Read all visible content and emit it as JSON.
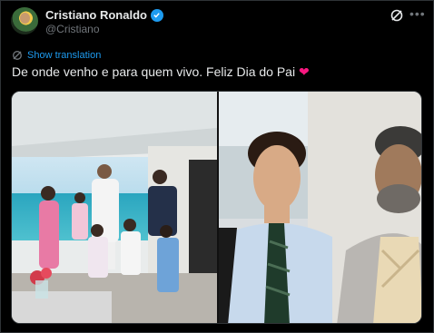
{
  "tweet": {
    "author_name": "Cristiano Ronaldo",
    "handle": "@Cristiano",
    "show_translation": "Show translation",
    "text": "De onde venho e para quem vivo. Feliz Dia do Pai",
    "emoji": "❤"
  },
  "icons": {
    "verified": "verified-badge-icon",
    "grok": "grok-icon",
    "more": "more-icon",
    "translate": "translate-icon"
  },
  "colors": {
    "background": "#000000",
    "text": "#e7e9ea",
    "secondary": "#71767b",
    "link": "#1d9bf0",
    "heart": "#f91880"
  }
}
